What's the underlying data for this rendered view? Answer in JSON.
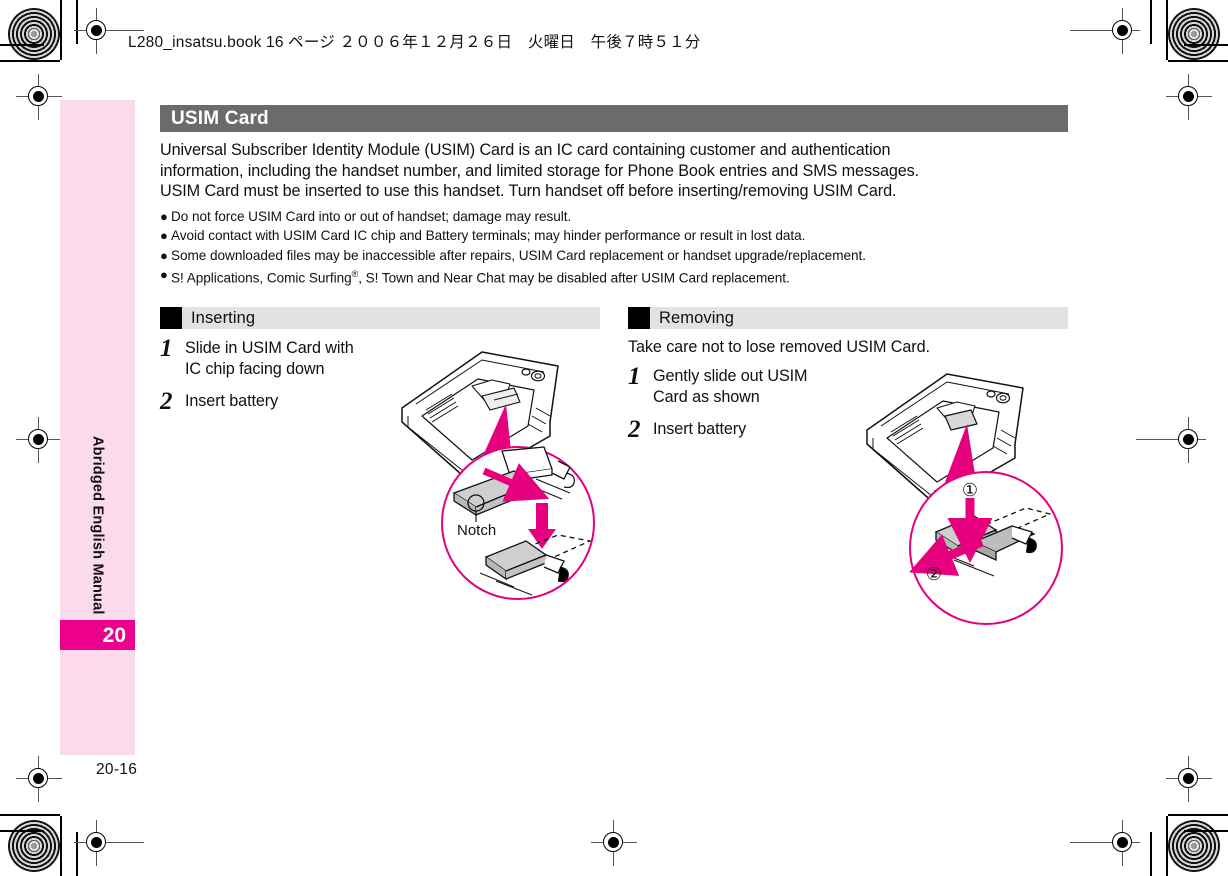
{
  "doc_header": "L280_insatsu.book  16 ページ  ２００６年１２月２６日　火曜日　午後７時５１分",
  "sidebar": {
    "label": "Abridged English Manual",
    "tab_number": "20",
    "page_number": "20-16",
    "bg_color": "#fadaeb",
    "tab_color": "#ec008c"
  },
  "section": {
    "title": "USIM Card",
    "title_bar_color": "#6b6b6b",
    "intro": [
      "Universal Subscriber Identity Module (USIM) Card is an IC card containing customer and authentication",
      "information, including the handset number, and limited storage for Phone Book entries and SMS messages.",
      "USIM Card must be inserted to use this handset. Turn handset off before inserting/removing USIM Card."
    ],
    "bullets": [
      {
        "pre": "Do not force USIM Card into or out of handset; damage may result.",
        "sup": "",
        "post": ""
      },
      {
        "pre": "Avoid contact with USIM Card IC chip and Battery terminals; may hinder performance or result in lost data.",
        "sup": "",
        "post": ""
      },
      {
        "pre": "Some downloaded files may be inaccessible after repairs, USIM Card replacement or handset upgrade/replacement.",
        "sup": "",
        "post": ""
      },
      {
        "pre": "S! Applications, Comic Surfing",
        "sup": "®",
        "post": ", S! Town and Near Chat may be disabled after USIM Card replacement."
      }
    ],
    "bullet_glyph": "●"
  },
  "columns": {
    "inserting": {
      "heading": "Inserting",
      "note": "",
      "steps": [
        {
          "num": "1",
          "lines": [
            "Slide in USIM Card with",
            "IC chip facing down"
          ]
        },
        {
          "num": "2",
          "lines": [
            "Insert battery"
          ]
        }
      ],
      "callout_label": "Notch"
    },
    "removing": {
      "heading": "Removing",
      "note": "Take care not to lose removed USIM Card.",
      "steps": [
        {
          "num": "1",
          "lines": [
            "Gently slide out USIM",
            "Card as shown"
          ]
        },
        {
          "num": "2",
          "lines": [
            "Insert battery"
          ]
        }
      ],
      "marker_one": "①",
      "marker_two": "②"
    }
  },
  "colors": {
    "accent_magenta": "#e6007e",
    "header_gray": "#6b6b6b",
    "subhead_gray": "#e2e2e2"
  }
}
